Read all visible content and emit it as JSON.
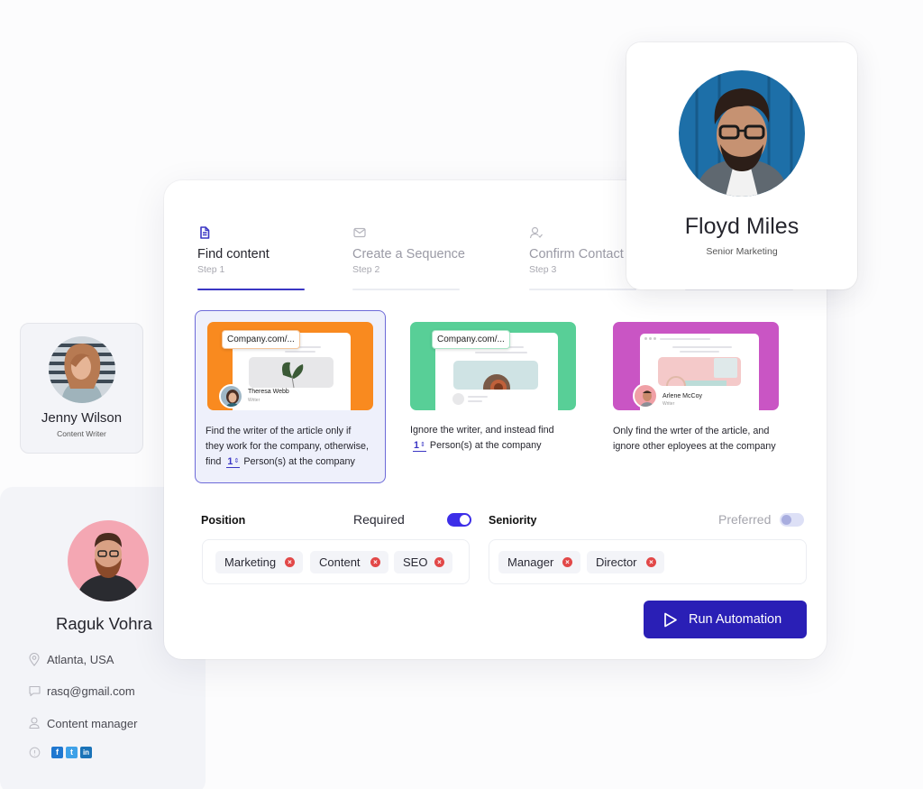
{
  "steps": [
    {
      "label": "Find content",
      "sub": "Step 1",
      "icon": "file-text-icon",
      "active": true
    },
    {
      "label": "Create a Sequence",
      "sub": "Step 2",
      "icon": "mail-icon",
      "active": false
    },
    {
      "label": "Confirm Contact",
      "sub": "Step 3",
      "icon": "user-check-icon",
      "active": false
    },
    {
      "label": "",
      "sub": "",
      "icon": "",
      "active": false
    }
  ],
  "option_cards": [
    {
      "selected": true,
      "url_label": "Company.com/...",
      "thumb_color": "#f98a1f",
      "writer_name": "Theresa Webb",
      "writer_role": "Writer",
      "line1": "Find the writer of the article only if",
      "line2": "they work for the company, otherwise,",
      "line3_prefix": "find",
      "stepper_value": "1",
      "line3_suffix": "Person(s) at  the company"
    },
    {
      "selected": false,
      "url_label": "Company.com/...",
      "thumb_color": "#58cf97",
      "line1": "Ignore the writer, and instead find",
      "stepper_value": "1",
      "line2_suffix": "Person(s) at the company"
    },
    {
      "selected": false,
      "thumb_color": "#c955c4",
      "writer_name": "Arlene McCoy",
      "writer_role": "Writer",
      "line1": "Only find the wrter of the article, and",
      "line2": "ignore other eployees at the company"
    }
  ],
  "position": {
    "label": "Position",
    "toggle_label": "Required",
    "toggle_on": true,
    "tags": [
      "Marketing",
      "Content",
      "SEO"
    ]
  },
  "seniority": {
    "label": "Seniority",
    "toggle_label": "Preferred",
    "toggle_on": false,
    "tags": [
      "Manager",
      "Director"
    ]
  },
  "run_button": {
    "label": "Run Automation",
    "icon": "play-icon"
  },
  "profiles": {
    "floyd": {
      "name": "Floyd Miles",
      "role": "Senior Marketing"
    },
    "jenny": {
      "name": "Jenny Wilson",
      "role": "Content Writer"
    },
    "raguk": {
      "name": "Raguk Vohra",
      "location": "Atlanta, USA",
      "email": "rasq@gmail.com",
      "job": "Content manager",
      "socials": [
        "facebook",
        "twitter",
        "linkedin"
      ]
    }
  },
  "colors": {
    "accent": "#3b36c4",
    "button": "#2a1fb6",
    "toggle_on": "#3d2ee8",
    "tag_remove": "#e24848",
    "facebook": "#1f77d0",
    "twitter": "#3ea1e8",
    "linkedin": "#1a73b8"
  }
}
